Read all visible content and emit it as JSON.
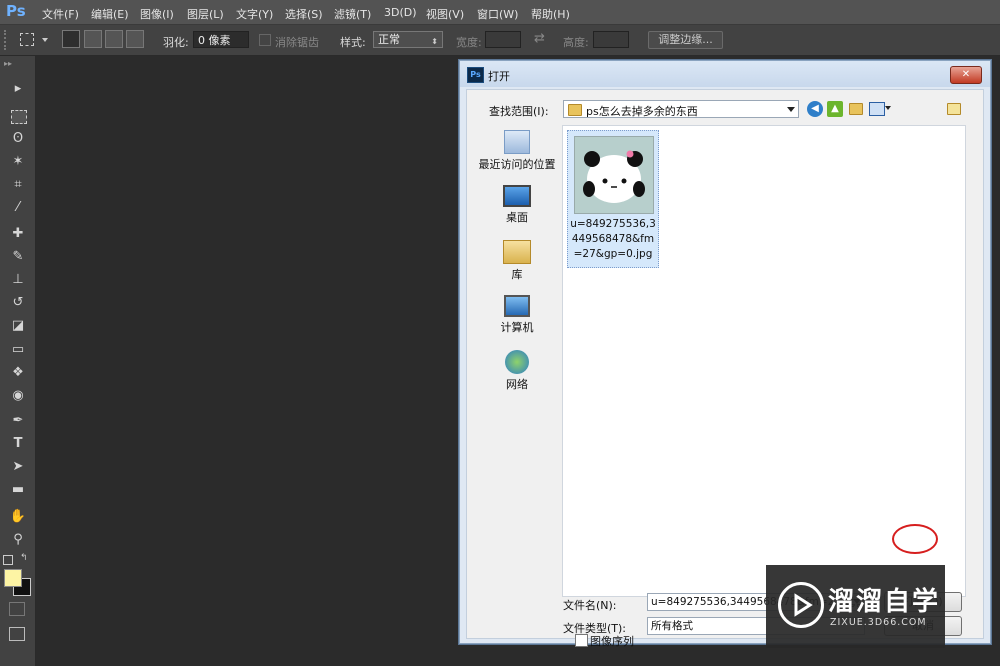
{
  "app": {
    "logo": "Ps"
  },
  "menu": [
    "文件(F)",
    "编辑(E)",
    "图像(I)",
    "图层(L)",
    "文字(Y)",
    "选择(S)",
    "滤镜(T)",
    "3D(D)",
    "视图(V)",
    "窗口(W)",
    "帮助(H)"
  ],
  "options": {
    "feather_label": "羽化:",
    "feather_value": "0 像素",
    "antialias_label": "消除锯齿",
    "style_label": "样式:",
    "style_value": "正常",
    "width_label": "宽度:",
    "height_label": "高度:",
    "refine_edge_button": "调整边缘..."
  },
  "tools": [
    "move-icon",
    "marquee-icon",
    "lasso-icon",
    "magic-wand-icon",
    "crop-icon",
    "eyedropper-icon",
    "healing-icon",
    "brush-icon",
    "stamp-icon",
    "history-brush-icon",
    "eraser-icon",
    "gradient-icon",
    "blur-icon",
    "dodge-icon",
    "pen-icon",
    "type-icon",
    "path-select-icon",
    "shape-icon",
    "hand-icon",
    "zoom-icon"
  ],
  "colors": {
    "foreground": "#fdf4a4",
    "background": "#111111"
  },
  "dialog": {
    "title": "打开",
    "close_label": "✕",
    "lookin_label": "查找范围(I):",
    "lookin_value": "ps怎么去掉多余的东西",
    "places": [
      {
        "label": "最近访问的位置",
        "icon": "recent-places-icon"
      },
      {
        "label": "桌面",
        "icon": "desktop-icon"
      },
      {
        "label": "库",
        "icon": "libraries-icon"
      },
      {
        "label": "计算机",
        "icon": "computer-icon"
      },
      {
        "label": "网络",
        "icon": "network-icon"
      }
    ],
    "files": [
      {
        "name": "u=849275536,3449568478&fm=27&gp=0.jpg",
        "selected": true
      }
    ],
    "filename_label": "文件名(N):",
    "filename_value": "u=849275536,3449568478&fm=27&gp=0.jpg",
    "filetype_label": "文件类型(T):",
    "filetype_value": "所有格式",
    "open_button": "打开(O)",
    "cancel_button": "取消",
    "image_sequence_label": "图像序列"
  },
  "watermark": {
    "brand": "溜溜自学",
    "url": "ZIXUE.3D66.COM"
  }
}
